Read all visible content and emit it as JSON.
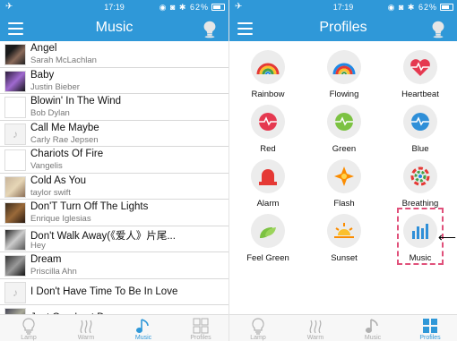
{
  "status_bar": {
    "time": "17:19",
    "battery": "62%"
  },
  "music_screen": {
    "title": "Music",
    "songs": [
      {
        "name": "Angel",
        "artist": "Sarah McLachlan",
        "thumb": "photo1"
      },
      {
        "name": "Baby",
        "artist": "Justin Bieber",
        "thumb": "photo2"
      },
      {
        "name": "Blowin' In The Wind",
        "artist": "Bob Dylan",
        "thumb": "blank"
      },
      {
        "name": "Call Me Maybe",
        "artist": "Carly Rae Jepsen",
        "thumb": "note"
      },
      {
        "name": "Chariots Of Fire",
        "artist": "Vangelis",
        "thumb": "blank"
      },
      {
        "name": "Cold As You",
        "artist": "taylor swift",
        "thumb": "photo4"
      },
      {
        "name": "Don'T Turn Off The Lights",
        "artist": "Enrique Iglesias",
        "thumb": "photo5"
      },
      {
        "name": "Don't Walk Away(《爱人》片尾...",
        "artist": "Hey",
        "thumb": "photo6"
      },
      {
        "name": "Dream",
        "artist": "Priscilla Ahn",
        "thumb": "photo7"
      },
      {
        "name": "I Don't Have Time To Be In Love",
        "artist": "",
        "thumb": "note"
      },
      {
        "name": "Just One Last Dance",
        "artist": "",
        "thumb": "photo3"
      }
    ]
  },
  "profiles_screen": {
    "title": "Profiles",
    "profiles": [
      {
        "label": "Rainbow",
        "icon": "rainbow-icon"
      },
      {
        "label": "Flowing",
        "icon": "flowing-rainbow-icon"
      },
      {
        "label": "Heartbeat",
        "icon": "heartbeat-icon"
      },
      {
        "label": "Red",
        "icon": "red-pulse-icon"
      },
      {
        "label": "Green",
        "icon": "green-pulse-icon"
      },
      {
        "label": "Blue",
        "icon": "blue-pulse-icon"
      },
      {
        "label": "Alarm",
        "icon": "alarm-icon"
      },
      {
        "label": "Flash",
        "icon": "flash-icon"
      },
      {
        "label": "Breathing",
        "icon": "breathing-icon"
      },
      {
        "label": "Feel Green",
        "icon": "leaves-icon"
      },
      {
        "label": "Sunset",
        "icon": "sunset-icon"
      },
      {
        "label": "Music",
        "icon": "music-bars-icon"
      }
    ]
  },
  "tabs": [
    {
      "label": "Lamp",
      "icon": "lamp-icon"
    },
    {
      "label": "Warm",
      "icon": "warm-icon"
    },
    {
      "label": "Music",
      "icon": "music-note-icon"
    },
    {
      "label": "Profiles",
      "icon": "profiles-grid-icon"
    }
  ],
  "colors": {
    "accent": "#2f98d8",
    "highlight": "#e0507a"
  }
}
